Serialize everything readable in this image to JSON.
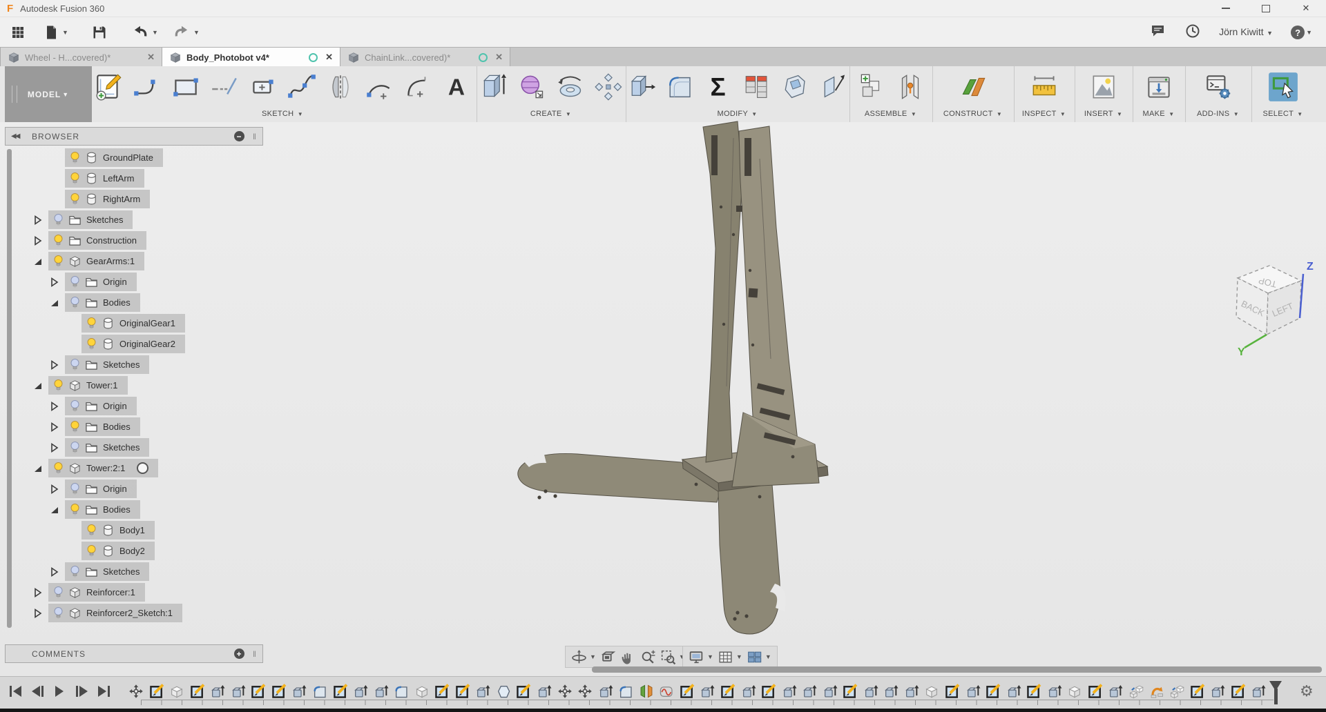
{
  "window": {
    "title": "Autodesk Fusion 360"
  },
  "app_toolbar": {
    "left_icons": [
      {
        "name": "app-grid-menu",
        "caret": false
      },
      {
        "name": "file-menu",
        "caret": true
      },
      {
        "name": "save",
        "caret": false
      },
      {
        "name": "undo",
        "caret": true
      },
      {
        "name": "redo",
        "caret": true
      }
    ],
    "right": {
      "user_name": "Jörn Kiwitt",
      "help_label": "?"
    }
  },
  "tabs": [
    {
      "label": "Wheel - H...covered)*",
      "active": false,
      "dot": false
    },
    {
      "label": "Body_Photobot v4*",
      "active": true,
      "dot": true
    },
    {
      "label": "ChainLink...covered)*",
      "active": false,
      "dot": true
    }
  ],
  "ribbon": {
    "workspace_label": "MODEL",
    "groups": [
      {
        "label": "SKETCH",
        "icons": [
          "sk-create",
          "sk-line",
          "sk-rect",
          "sk-constr",
          "sk-slot",
          "sk-spline",
          "sk-mirror",
          "sk-arc",
          "sk-arc2",
          "sk-text"
        ]
      },
      {
        "label": "CREATE",
        "icons": [
          "cr-extrude",
          "cr-form",
          "cr-revolve",
          "cr-pattern"
        ]
      },
      {
        "label": "MODIFY",
        "icons": [
          "mo-press",
          "mo-fillet",
          "mo-sigma",
          "mo-params",
          "mo-split",
          "mo-draft"
        ]
      },
      {
        "label": "ASSEMBLE",
        "icons": [
          "as-newcomp",
          "as-joint"
        ]
      },
      {
        "label": "CONSTRUCT",
        "icons": [
          "co-plane"
        ]
      },
      {
        "label": "INSPECT",
        "icons": [
          "in-measure"
        ]
      },
      {
        "label": "INSERT",
        "icons": [
          "ins-image"
        ]
      },
      {
        "label": "MAKE",
        "icons": [
          "mk-print"
        ]
      },
      {
        "label": "ADD-INS",
        "icons": [
          "ai-console"
        ]
      },
      {
        "label": "SELECT",
        "icons": [
          "se-select"
        ]
      }
    ]
  },
  "browser": {
    "title": "BROWSER",
    "items": [
      {
        "label": "GroundPlate",
        "level": 2,
        "bulb": "on",
        "icon": "body",
        "exp": "none"
      },
      {
        "label": "LeftArm",
        "level": 2,
        "bulb": "on",
        "icon": "body",
        "exp": "none"
      },
      {
        "label": "RightArm",
        "level": 2,
        "bulb": "on",
        "icon": "body",
        "exp": "none"
      },
      {
        "label": "Sketches",
        "level": 1,
        "bulb": "off",
        "icon": "folder",
        "exp": "collapsed"
      },
      {
        "label": "Construction",
        "level": 1,
        "bulb": "on",
        "icon": "folder",
        "exp": "collapsed"
      },
      {
        "label": "GearArms:1",
        "level": 1,
        "bulb": "on",
        "icon": "component",
        "exp": "expanded"
      },
      {
        "label": "Origin",
        "level": 2,
        "bulb": "off",
        "icon": "folder",
        "exp": "collapsed"
      },
      {
        "label": "Bodies",
        "level": 2,
        "bulb": "off",
        "icon": "folder",
        "exp": "expanded"
      },
      {
        "label": "OriginalGear1",
        "level": 3,
        "bulb": "on",
        "icon": "body",
        "exp": "none"
      },
      {
        "label": "OriginalGear2",
        "level": 3,
        "bulb": "on",
        "icon": "body",
        "exp": "none"
      },
      {
        "label": "Sketches",
        "level": 2,
        "bulb": "off",
        "icon": "folder",
        "exp": "collapsed"
      },
      {
        "label": "Tower:1",
        "level": 1,
        "bulb": "on",
        "icon": "component",
        "exp": "expanded"
      },
      {
        "label": "Origin",
        "level": 2,
        "bulb": "off",
        "icon": "folder",
        "exp": "collapsed"
      },
      {
        "label": "Bodies",
        "level": 2,
        "bulb": "on",
        "icon": "folder",
        "exp": "collapsed"
      },
      {
        "label": "Sketches",
        "level": 2,
        "bulb": "off",
        "icon": "folder",
        "exp": "collapsed"
      },
      {
        "label": "Tower:2:1",
        "level": 1,
        "bulb": "on",
        "icon": "component",
        "exp": "expanded",
        "radio": true
      },
      {
        "label": "Origin",
        "level": 2,
        "bulb": "off",
        "icon": "folder",
        "exp": "collapsed"
      },
      {
        "label": "Bodies",
        "level": 2,
        "bulb": "on",
        "icon": "folder",
        "exp": "expanded"
      },
      {
        "label": "Body1",
        "level": 3,
        "bulb": "on",
        "icon": "body",
        "exp": "none"
      },
      {
        "label": "Body2",
        "level": 3,
        "bulb": "on",
        "icon": "body",
        "exp": "none"
      },
      {
        "label": "Sketches",
        "level": 2,
        "bulb": "off",
        "icon": "folder",
        "exp": "collapsed"
      },
      {
        "label": "Reinforcer:1",
        "level": 1,
        "bulb": "off",
        "icon": "component",
        "exp": "collapsed"
      },
      {
        "label": "Reinforcer2_Sketch:1",
        "level": 1,
        "bulb": "off",
        "icon": "component",
        "exp": "collapsed"
      }
    ]
  },
  "comments": {
    "title": "COMMENTS"
  },
  "navbar": {
    "groups": [
      {
        "icons": [
          {
            "n": "orbit",
            "caret": true
          },
          {
            "n": "lookat",
            "caret": false
          },
          {
            "n": "pan",
            "caret": false
          },
          {
            "n": "zoom",
            "caret": false
          },
          {
            "n": "zoomwin",
            "caret": true
          }
        ]
      },
      {
        "icons": [
          {
            "n": "display",
            "caret": true
          },
          {
            "n": "grid",
            "caret": true
          },
          {
            "n": "viewports",
            "caret": true
          }
        ]
      }
    ]
  },
  "viewcube": {
    "faces": {
      "top": "TOP",
      "left": "BACK",
      "right": "LEFT"
    },
    "axes": {
      "z": "Z",
      "y": "Y"
    },
    "axis_colors": {
      "z": "#4a5fd0",
      "y": "#58b33e"
    }
  },
  "timeline": {
    "features": [
      "move",
      "sketch",
      "body",
      "sketch",
      "extrude",
      "extrude",
      "sketch",
      "sketch",
      "extrude",
      "fillet",
      "sketch",
      "extrude",
      "extrude",
      "fillet",
      "body",
      "sketch",
      "sketch",
      "extrude",
      "chamfer",
      "sketch",
      "extrude",
      "move",
      "move",
      "extrude",
      "fillet",
      "mirror",
      "form",
      "sketch",
      "extrude",
      "sketch",
      "extrude",
      "sketch",
      "extrude",
      "extrude",
      "extrude",
      "sketch",
      "extrude",
      "extrude",
      "extrude",
      "body",
      "sketch",
      "extrude",
      "sketch",
      "extrude",
      "sketch",
      "extrude",
      "body",
      "sketch",
      "extrude",
      "copy",
      "flip",
      "copy",
      "sketch",
      "extrude",
      "sketch",
      "extrude"
    ]
  },
  "colors": {
    "accent_teal": "#4fc3ad",
    "select_highlight": "#6da5cc",
    "bulb_on": "#ffd43a",
    "bulb_off": "#ccd6f0",
    "model_tan": "#8f8a78"
  }
}
